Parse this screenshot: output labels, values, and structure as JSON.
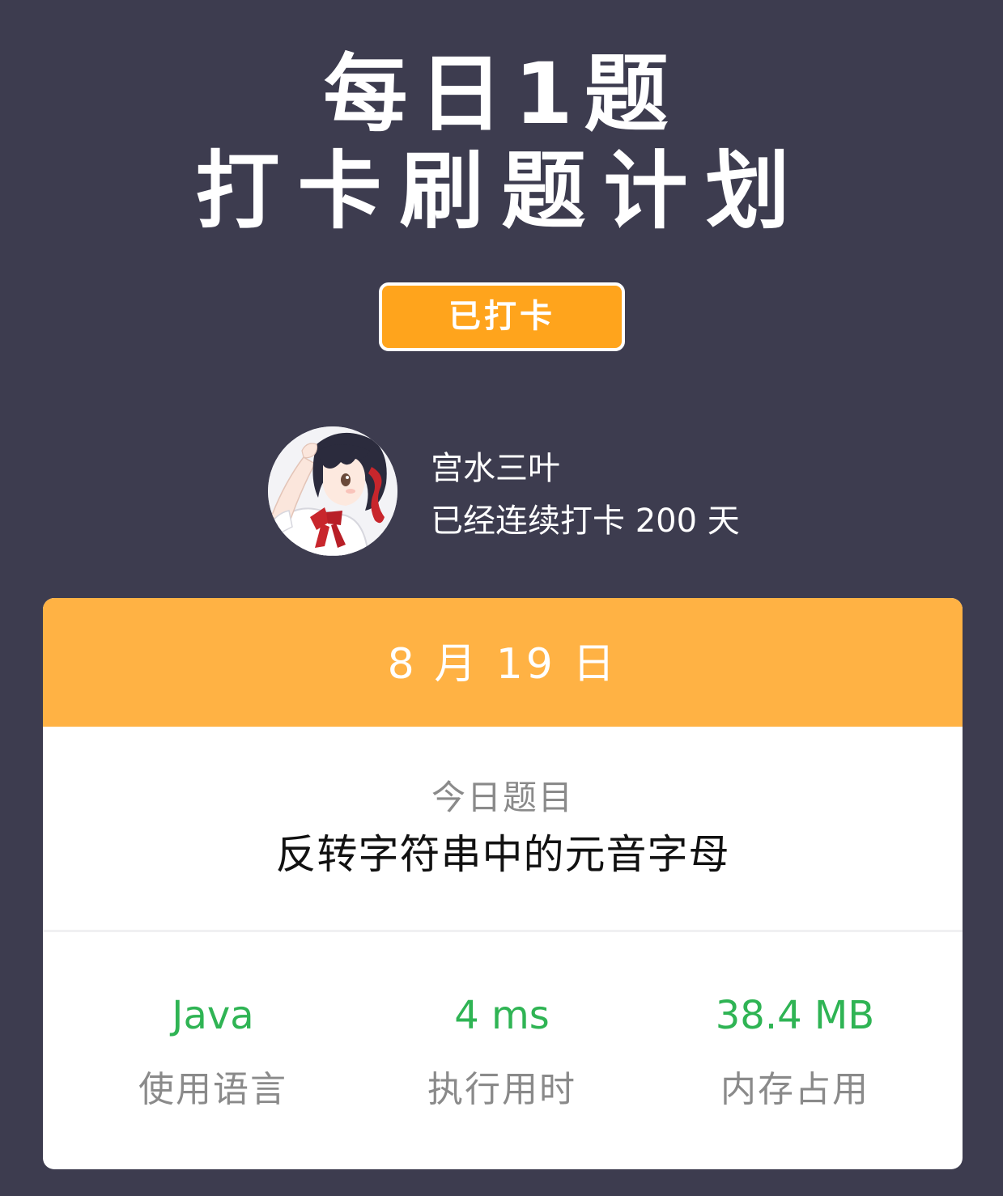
{
  "hero": {
    "line1": "每日1题",
    "line2": "打卡刷题计划"
  },
  "checkin": {
    "label": "已打卡"
  },
  "user": {
    "name": "宫水三叶",
    "streak_text": "已经连续打卡 200 天"
  },
  "card": {
    "date": "8 月 19 日",
    "problem_caption": "今日题目",
    "problem_title": "反转字符串中的元音字母",
    "stats": [
      {
        "value": "Java",
        "label": "使用语言"
      },
      {
        "value": "4 ms",
        "label": "执行用时"
      },
      {
        "value": "38.4 MB",
        "label": "内存占用"
      }
    ]
  },
  "colors": {
    "background": "#3d3c4f",
    "button_orange": "#ffa41c",
    "header_orange": "#ffb244",
    "stat_green": "#2fb454",
    "caption_gray": "#8a8a8a"
  }
}
